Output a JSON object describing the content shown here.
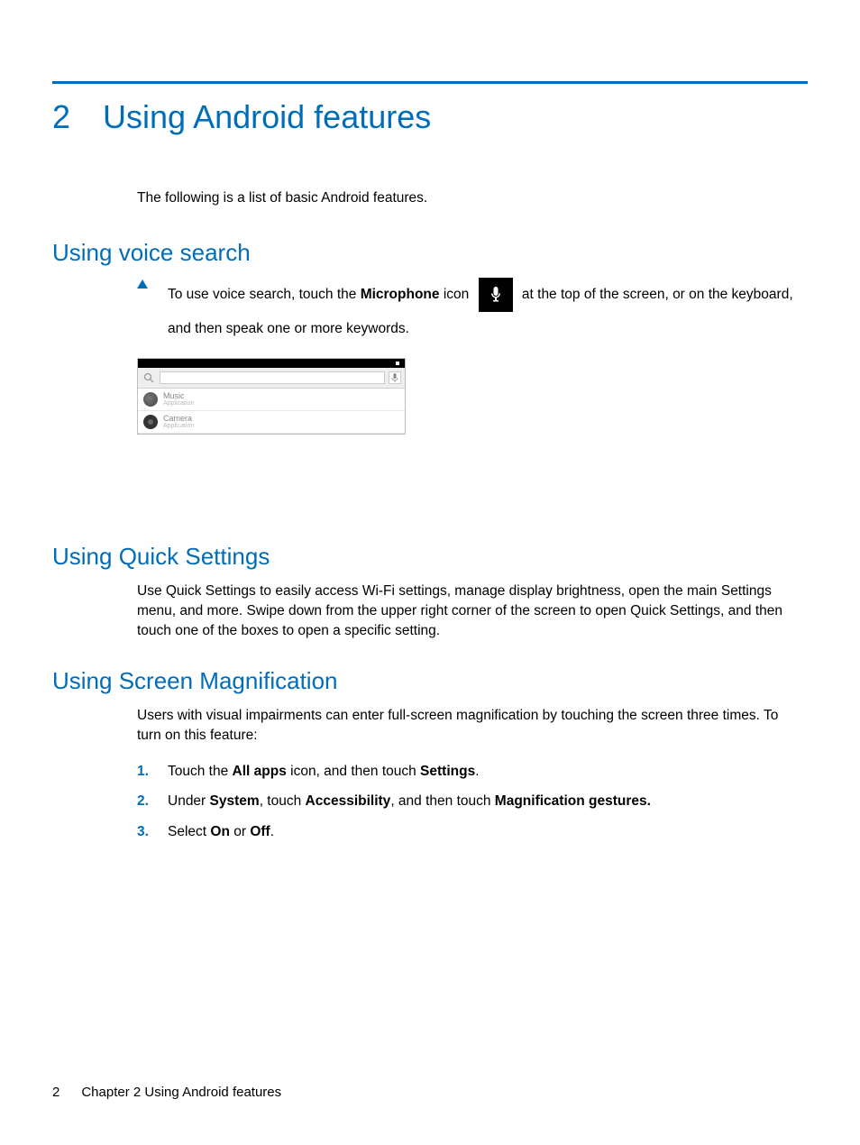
{
  "chapter": {
    "number": "2",
    "title": "Using Android features"
  },
  "intro": "The following is a list of basic Android features.",
  "sections": {
    "voice": {
      "heading": "Using voice search",
      "p_pre": "To use voice search, touch the ",
      "p_bold_mic": "Microphone",
      "p_mid": " icon ",
      "p_post": " at the top of the screen, or on the keyboard, and then speak one or more keywords.",
      "ss_items": [
        {
          "title": "Music",
          "sub": "Application"
        },
        {
          "title": "Camera",
          "sub": "Application"
        }
      ]
    },
    "quick": {
      "heading": "Using Quick Settings",
      "p": "Use Quick Settings to easily access Wi-Fi settings, manage display brightness, open the main Settings menu, and more. Swipe down from the upper right corner of the screen to open Quick Settings, and then touch one of the boxes to open a specific setting."
    },
    "mag": {
      "heading": "Using Screen Magnification",
      "p": "Users with visual impairments can enter full-screen magnification by touching the screen three times. To turn on this feature:",
      "steps": [
        {
          "pre": "Touch the ",
          "b1": "All apps",
          "mid": " icon, and then touch ",
          "b2": "Settings",
          "post": "."
        },
        {
          "pre": "Under ",
          "b1": "System",
          "mid": ", touch ",
          "b2": "Accessibility",
          "mid2": ", and then touch ",
          "b3": "Magnification gestures.",
          "post": ""
        },
        {
          "pre": "Select ",
          "b1": "On",
          "mid": " or ",
          "b2": "Off",
          "post": "."
        }
      ]
    }
  },
  "footer": {
    "page": "2",
    "label": "Chapter 2   Using Android features"
  }
}
